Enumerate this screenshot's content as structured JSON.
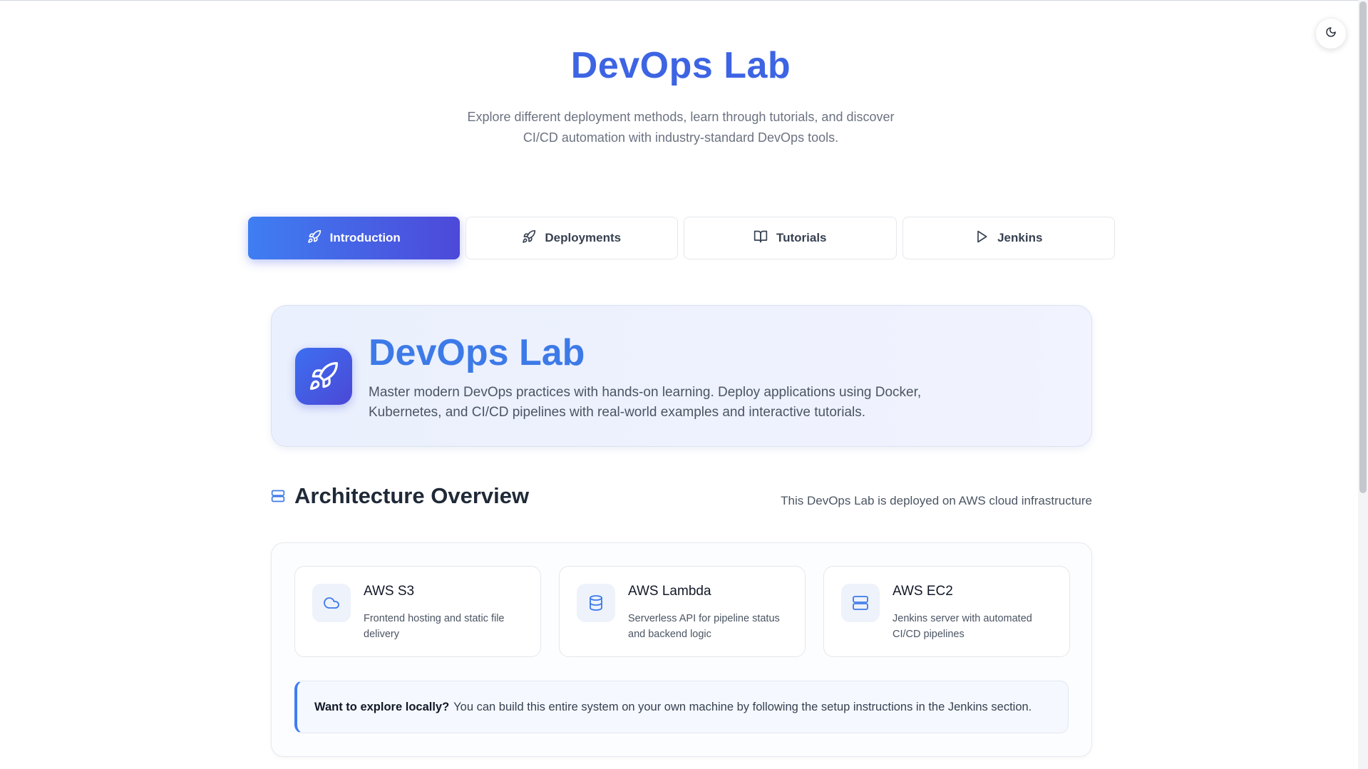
{
  "hero": {
    "title": "DevOps Lab",
    "subtitle": "Explore different deployment methods, learn through tutorials, and discover CI/CD automation with industry-standard DevOps tools."
  },
  "theme_toggle": {
    "icon": "moon-icon"
  },
  "tabs": [
    {
      "label": "Introduction",
      "icon": "rocket-icon",
      "active": true
    },
    {
      "label": "Deployments",
      "icon": "rocket-icon",
      "active": false
    },
    {
      "label": "Tutorials",
      "icon": "book-open-icon",
      "active": false
    },
    {
      "label": "Jenkins",
      "icon": "play-icon",
      "active": false
    }
  ],
  "intro": {
    "icon": "rocket-icon",
    "title": "DevOps Lab",
    "description": "Master modern DevOps practices with hands-on learning. Deploy applications using Docker, Kubernetes, and CI/CD pipelines with real-world examples and interactive tutorials."
  },
  "architecture": {
    "icon": "server-icon",
    "title": "Architecture Overview",
    "note": "This DevOps Lab is deployed on AWS cloud infrastructure",
    "services": [
      {
        "name": "AWS S3",
        "description": "Frontend hosting and static file delivery",
        "icon": "cloud-icon"
      },
      {
        "name": "AWS Lambda",
        "description": "Serverless API for pipeline status and backend logic",
        "icon": "database-icon"
      },
      {
        "name": "AWS EC2",
        "description": "Jenkins server with automated CI/CD pipelines",
        "icon": "server-icon"
      }
    ],
    "callout": {
      "lead": "Want to explore locally?",
      "text": "You can build this entire system on your own machine by following the setup instructions in the Jenkins section."
    }
  },
  "colors": {
    "accent": "#3d64e3",
    "tab_gradient_start": "#3f7ef2",
    "tab_gradient_end": "#4d49d9"
  }
}
